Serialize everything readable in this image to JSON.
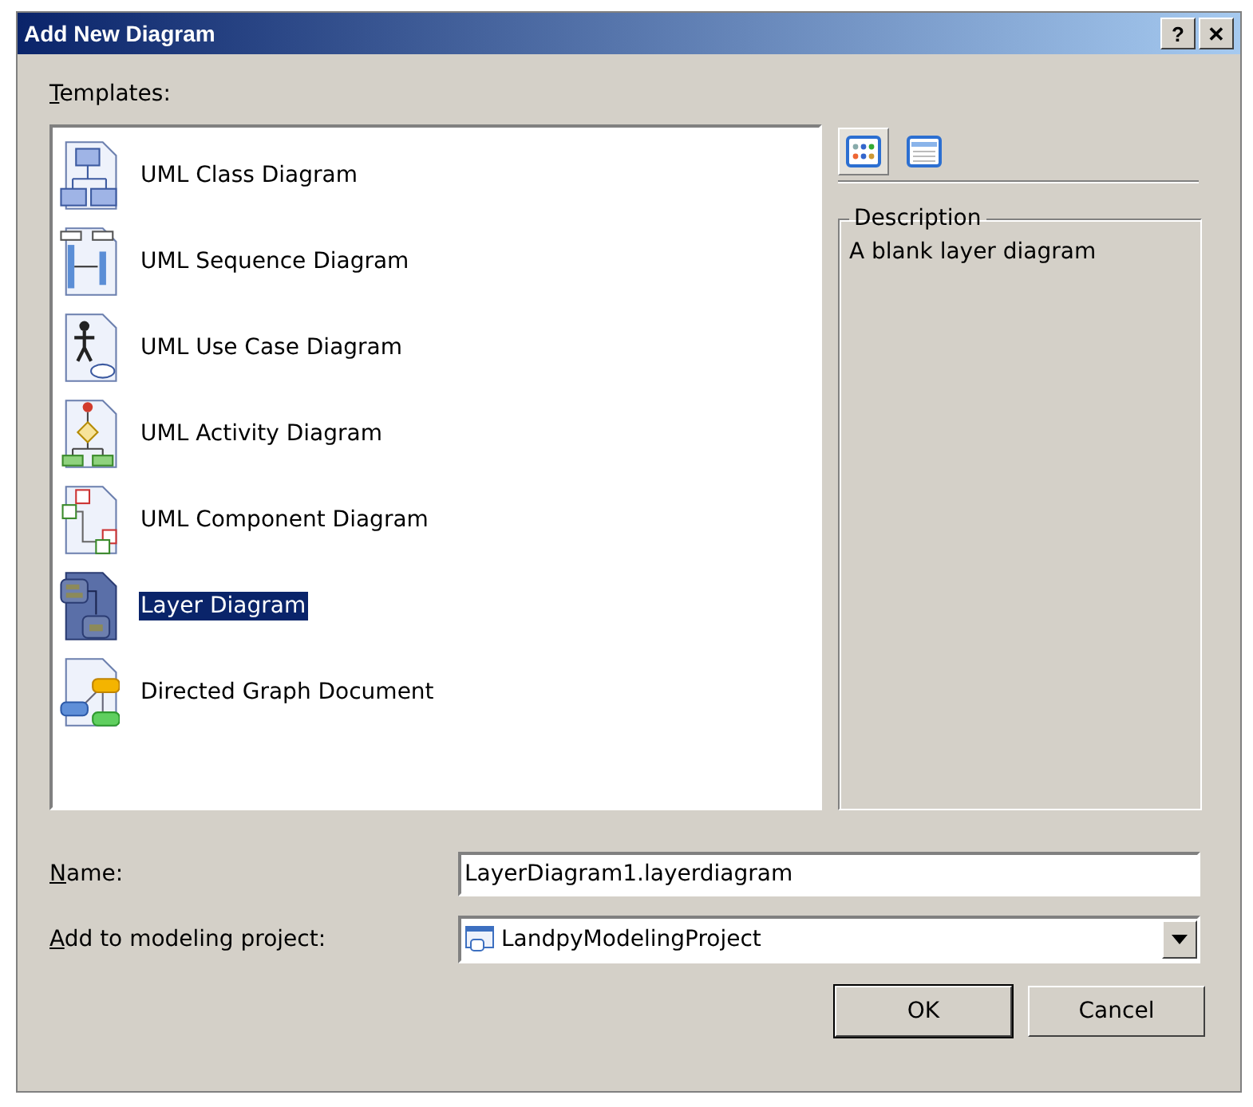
{
  "window": {
    "title": "Add New Diagram",
    "buttons": [
      "?",
      "✕"
    ]
  },
  "templates_label": {
    "text": "Templates:",
    "access_key_underlined": true
  },
  "templates": [
    {
      "label": "UML Class Diagram",
      "kind": "class",
      "selected": false
    },
    {
      "label": "UML Sequence Diagram",
      "kind": "sequence",
      "selected": false
    },
    {
      "label": "UML Use Case Diagram",
      "kind": "usecase",
      "selected": false
    },
    {
      "label": "UML Activity Diagram",
      "kind": "activity",
      "selected": false
    },
    {
      "label": "UML Component Diagram",
      "kind": "component",
      "selected": false
    },
    {
      "label": "Layer Diagram",
      "kind": "layer",
      "selected": true
    },
    {
      "label": "Directed Graph Document",
      "kind": "graph",
      "selected": false
    }
  ],
  "view_buttons": [
    {
      "kind": "large-icons",
      "selected": true
    },
    {
      "kind": "details",
      "selected": false
    }
  ],
  "description": {
    "title": "Description",
    "text": "A blank layer diagram"
  },
  "name": {
    "label": "Name:",
    "access_key_underlined": true,
    "value": "LayerDiagram1.layerdiagram"
  },
  "project": {
    "label": "Add to modeling project:",
    "access_key_underlined": true,
    "value": "LandpyModelingProject"
  },
  "buttons": [
    {
      "label": "OK",
      "default": true
    },
    {
      "label": "Cancel",
      "default": false
    }
  ]
}
